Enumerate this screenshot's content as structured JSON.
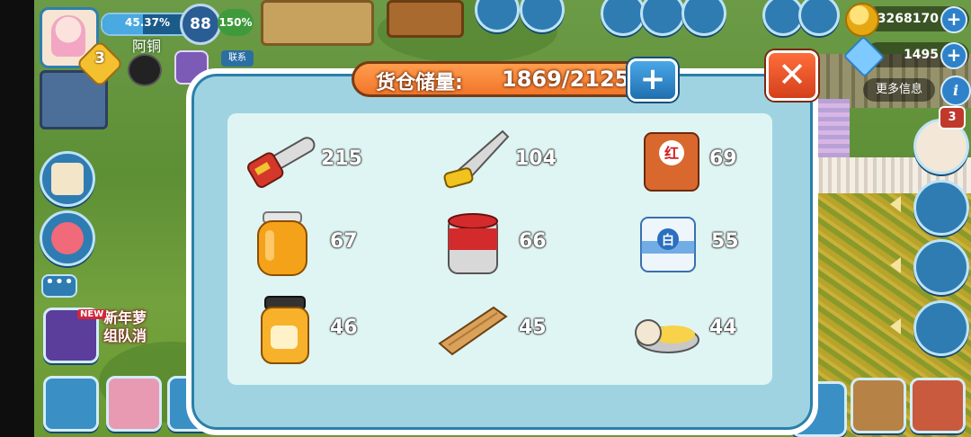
{
  "player": {
    "name": "阿铜",
    "level": "3",
    "xp_text": "45.37%",
    "xp_fraction": 0.4537,
    "rank": "88",
    "bonus": "150%"
  },
  "resources": {
    "coins": "3268170",
    "gems": "1495",
    "more_info": "更多信息",
    "friend_label": "联系",
    "quest_badge": "3"
  },
  "promo": {
    "line1": "新年萝",
    "line2": "组队消",
    "new_label": "NEW"
  },
  "dialog": {
    "title": "货仓储量:",
    "capacity_text": "1869/2125",
    "add_label": "+",
    "close_label": "✕",
    "items": [
      {
        "name": "chainsaw",
        "count": "215"
      },
      {
        "name": "saw",
        "count": "104"
      },
      {
        "name": "red-bag",
        "count": "69",
        "tag": "红"
      },
      {
        "name": "honey-jar",
        "count": "67"
      },
      {
        "name": "paint-bucket",
        "count": "66"
      },
      {
        "name": "white-bag",
        "count": "55",
        "tag": "白"
      },
      {
        "name": "honey-pot",
        "count": "46"
      },
      {
        "name": "wood-plank",
        "count": "45"
      },
      {
        "name": "wax-tin",
        "count": "44"
      }
    ]
  },
  "colors": {
    "dialog_bg": "#9fd3e2",
    "panel_bg": "#dff5f3",
    "title_orange": "#f2762a",
    "close_red": "#d5401c",
    "button_blue": "#2f82c9"
  }
}
